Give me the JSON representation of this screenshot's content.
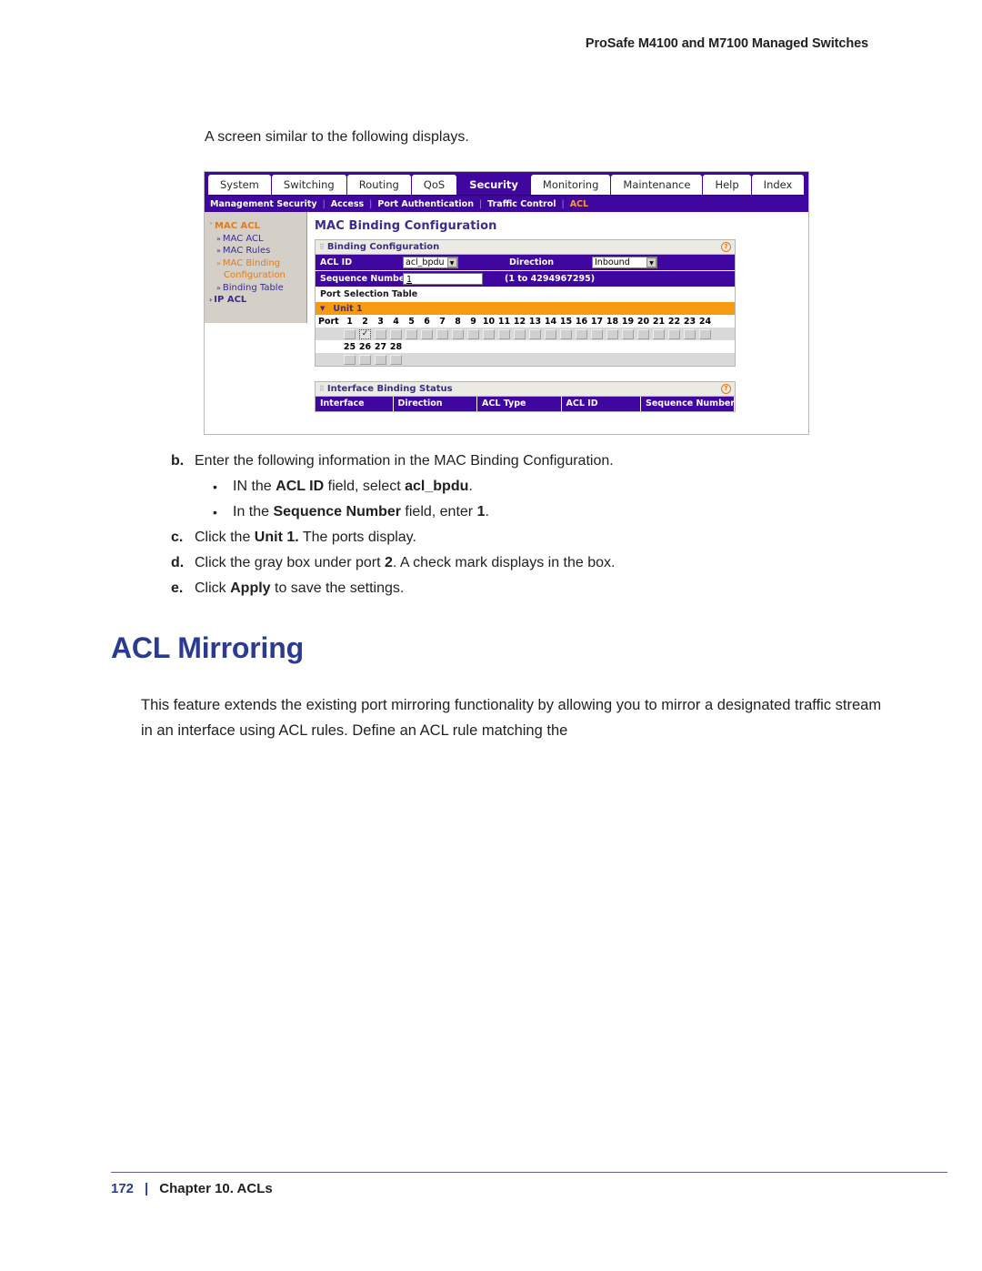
{
  "document": {
    "header": "ProSafe M4100 and M7100 Managed Switches",
    "intro_line": "A screen similar to the following displays.",
    "heading": "ACL Mirroring",
    "body_paragraph": "This feature extends the existing port mirroring functionality by allowing you to mirror a designated traffic stream in an interface using ACL rules. Define an ACL rule matching the",
    "footer": {
      "page_number": "172",
      "separator": "|",
      "chapter": "Chapter 10.  ACLs"
    },
    "steps": [
      {
        "letter": "b.",
        "text_html": "Enter the following information in the MAC Binding Configuration."
      },
      {
        "letter": "c.",
        "text_html": "Click the <b>Unit 1.</b> The ports display."
      },
      {
        "letter": "d.",
        "text_html": "Click the gray box under port <b>2</b>. A check mark displays in the box."
      },
      {
        "letter": "e.",
        "text_html": "Click <b>Apply</b> to save the settings."
      }
    ],
    "bullets": [
      {
        "text_html": "IN the <b>ACL ID</b> field, select <b>acl_bpdu</b>."
      },
      {
        "text_html": "In the <b>Sequence Number</b> field, enter <b>1</b>."
      }
    ]
  },
  "screenshot": {
    "tabs": [
      {
        "label": "System",
        "active": false
      },
      {
        "label": "Switching",
        "active": false
      },
      {
        "label": "Routing",
        "active": false
      },
      {
        "label": "QoS",
        "active": false
      },
      {
        "label": "Security",
        "active": true
      },
      {
        "label": "Monitoring",
        "active": false
      },
      {
        "label": "Maintenance",
        "active": false
      },
      {
        "label": "Help",
        "active": false
      },
      {
        "label": "Index",
        "active": false
      }
    ],
    "subnav": [
      {
        "label": "Management Security",
        "active": false
      },
      {
        "label": "Access",
        "active": false
      },
      {
        "label": "Port Authentication",
        "active": false
      },
      {
        "label": "Traffic Control",
        "active": false
      },
      {
        "label": "ACL",
        "active": true
      }
    ],
    "subnav_separator": "|",
    "sidebar": [
      {
        "label": "MAC ACL",
        "type": "group",
        "bullet": "˅",
        "active": false
      },
      {
        "label": "MAC ACL",
        "type": "child",
        "bullet": "»",
        "active": false
      },
      {
        "label": "MAC Rules",
        "type": "child",
        "bullet": "»",
        "active": false
      },
      {
        "label": "MAC Binding",
        "type": "child",
        "bullet": "»",
        "active": true
      },
      {
        "label": "Configuration",
        "type": "child-cont",
        "bullet": "",
        "active": true
      },
      {
        "label": "Binding Table",
        "type": "child",
        "bullet": "»",
        "active": false
      },
      {
        "label": "IP ACL",
        "type": "group-collapsed",
        "bullet": "›",
        "active": false
      }
    ],
    "panel_title": "MAC Binding Configuration",
    "binding_configuration": {
      "section_label": "Binding Configuration",
      "help_glyph": "?",
      "acl_id_label": "ACL ID",
      "acl_id_value": "acl_bpdu",
      "direction_label": "Direction",
      "direction_value": "Inbound",
      "sequence_label": "Sequence Number",
      "sequence_value": "1",
      "sequence_hint": "(1 to 4294967295)"
    },
    "port_selection": {
      "title": "Port Selection Table",
      "unit_label": "Unit 1",
      "port_header": "Port",
      "row1_ports": [
        "1",
        "2",
        "3",
        "4",
        "5",
        "6",
        "7",
        "8",
        "9",
        "10",
        "11",
        "12",
        "13",
        "14",
        "15",
        "16",
        "17",
        "18",
        "19",
        "20",
        "21",
        "22",
        "23",
        "24"
      ],
      "row1_checked": [
        "2"
      ],
      "row2_ports": [
        "25",
        "26",
        "27",
        "28"
      ],
      "row2_checked": [],
      "check_glyph": "✓"
    },
    "interface_binding_status": {
      "section_label": "Interface Binding Status",
      "help_glyph": "?",
      "columns": [
        "Interface",
        "Direction",
        "ACL Type",
        "ACL ID",
        "Sequence Number"
      ]
    },
    "colors": {
      "nav_purple": "#3f07a0",
      "accent_orange": "#f79a10",
      "heading_blue": "#2c3b8f",
      "sidebar_gray": "#d4d0c8"
    }
  }
}
